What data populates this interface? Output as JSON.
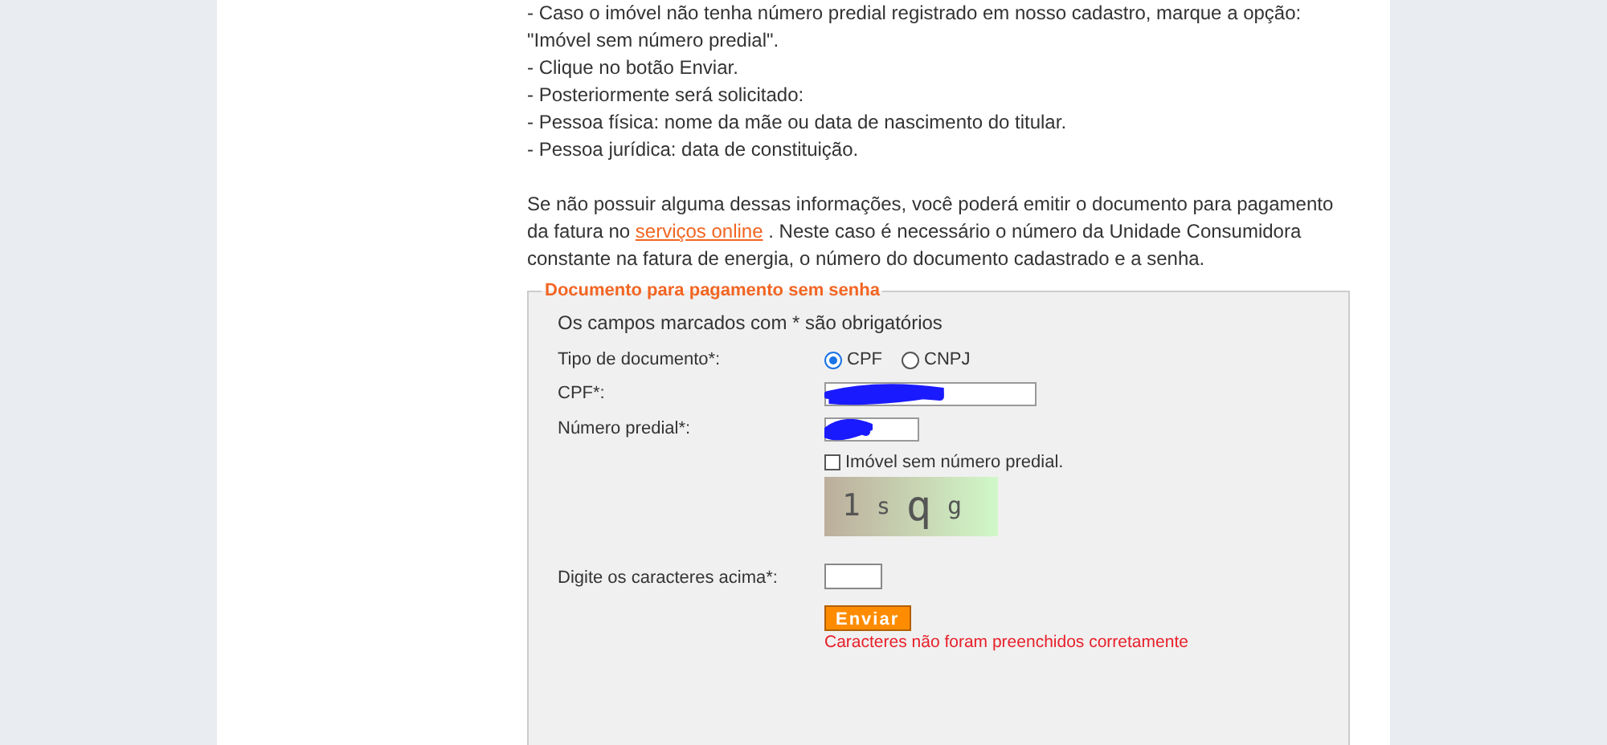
{
  "instructions": [
    "- Caso o imóvel não tenha número predial registrado em nosso cadastro, marque a opção: \"Imóvel sem número predial\".",
    "- Clique no botão Enviar.",
    "- Posteriormente será solicitado:",
    "- Pessoa física: nome da mãe ou data de nascimento do titular.",
    "- Pessoa jurídica: data de constituição."
  ],
  "note": {
    "before": "Se não possuir alguma dessas informações, você poderá emitir o documento para pagamento da fatura no",
    "link": "serviços online",
    "after": ". Neste caso é necessário o número da Unidade Consumidora constante na fatura de energia, o número do documento cadastrado e a senha."
  },
  "form": {
    "legend": "Documento para pagamento sem senha",
    "required_note": "Os campos marcados com * são obrigatórios",
    "document_type": {
      "label": "Tipo de documento*:",
      "options": [
        {
          "label": "CPF",
          "selected": true
        },
        {
          "label": "CNPJ",
          "selected": false
        }
      ]
    },
    "cpf": {
      "label": "CPF*:",
      "redacted": true
    },
    "building_number": {
      "label": "Número predial*:",
      "redacted": true
    },
    "no_number": {
      "label": "Imóvel sem número predial.",
      "checked": false
    },
    "captcha": {
      "characters": [
        "1",
        "s",
        "q",
        "g"
      ]
    },
    "captcha_input": {
      "label": "Digite os caracteres acima*:"
    },
    "submit": "Enviar",
    "error": "Caracteres não foram preenchidos corretamente"
  }
}
